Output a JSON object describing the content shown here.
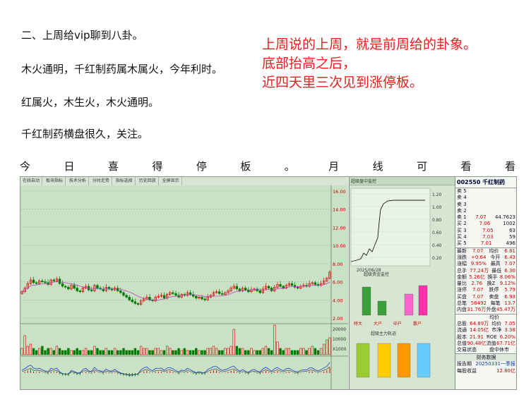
{
  "paragraphs": [
    "二、上周给vip聊到八卦。",
    "木火通明，千红制药属木属火，今年利时。",
    "红属火，木生火，木火通明。",
    "千红制药横盘很久，关注。"
  ],
  "red_note": [
    "上周说的上周，就是前周给的卦象。",
    "底部抬高之后，",
    "近四天里三次见到涨停板。"
  ],
  "spaced_line": [
    "今",
    "日",
    "喜",
    "得",
    "停",
    "板",
    "。",
    "月",
    "线",
    "可",
    "看",
    "看"
  ],
  "software": {
    "toolbar": [
      "在线自动",
      "板块指标",
      "技术分析",
      "分时走势",
      "指标选择",
      "历史回放",
      "全屏显示"
    ],
    "kline_axis": [
      "16.00",
      "14.00",
      "12.00",
      "10.00",
      "8.00",
      "6.00",
      "4.00",
      "2.00"
    ],
    "vol_axis": [
      "20000",
      "10000",
      "X1000"
    ],
    "mid_top_label": "超级盘中监控",
    "mid_axis": [
      "1.20",
      "1.00",
      "0.80",
      "0.60",
      "0.40",
      "0.20"
    ],
    "mid_date": "2025/06/28",
    "mid_mid_label": "超级资金监控",
    "mid_bottom_label": "超级主力轨迹",
    "mid_cats": [
      "特大",
      "大户",
      "中户",
      "散户"
    ],
    "stock_title": "002550 千红制药",
    "order_book": [
      {
        "side": "卖",
        "n": "5",
        "p": "",
        "v": ""
      },
      {
        "side": "卖",
        "n": "4",
        "p": "",
        "v": ""
      },
      {
        "side": "卖",
        "n": "3",
        "p": "",
        "v": ""
      },
      {
        "side": "卖",
        "n": "2",
        "p": "",
        "v": ""
      },
      {
        "side": "卖",
        "n": "1",
        "p": "7.07",
        "v": "44.7623"
      },
      {
        "side": "买",
        "n": "2",
        "p": "7.06",
        "v": "1002"
      },
      {
        "side": "买",
        "n": "3",
        "p": "7.05",
        "v": "63"
      },
      {
        "side": "买",
        "n": "4",
        "p": "7.03",
        "v": "59"
      },
      {
        "side": "买",
        "n": "5",
        "p": "7.01",
        "v": "496"
      }
    ],
    "stats": [
      [
        "最新",
        "7.07",
        "均价",
        "6.81"
      ],
      [
        "涨跌",
        "+0.64",
        "今开",
        "6.43"
      ],
      [
        "涨幅",
        "9.95%",
        "最高",
        "7.07"
      ],
      [
        "总手",
        "77.24万",
        "最低",
        "6.30"
      ],
      [
        "金额",
        "5.26亿",
        "换手",
        "8.06%"
      ],
      [
        "量比",
        "2.76",
        "换Z",
        "9.12%"
      ],
      [
        "涨停",
        "7.07",
        "跌停",
        "5.79"
      ],
      [
        "买盘",
        "7.07",
        "卖盘",
        "6.93"
      ],
      [
        "总笔",
        "56492",
        "每笔",
        "13.7"
      ],
      [
        "内盘",
        "31.76万",
        "外盘",
        "45.47万"
      ]
    ],
    "stats2": [
      [
        "",
        "",
        "均价",
        ""
      ],
      [
        "总股",
        "64.89万",
        "均价",
        "7.05"
      ],
      [
        "流通",
        "14.05亿",
        "市净",
        "3.38"
      ],
      [
        "股本",
        "21.91",
        "ROE",
        "6.20%"
      ],
      [
        "总值",
        "90.48亿",
        "流值",
        "67.71亿"
      ],
      [
        "交易状态",
        "",
        "盘中休市",
        ""
      ]
    ],
    "bottom_tabs": "财务数据",
    "report": [
      "报告期",
      "20250331一季报",
      "每股收益",
      "12.80亿"
    ]
  },
  "chart_data": {
    "type": "candlestick",
    "y_axis": [
      2,
      16
    ],
    "closes": [
      4.9,
      5.3,
      5.8,
      6.2,
      5.9,
      5.8,
      6.1,
      6.0,
      5.9,
      5.7,
      6.2,
      6.1,
      6.3,
      5.8,
      5.5,
      5.4,
      5.2,
      5.6,
      5.3,
      5.0,
      4.9,
      5.3,
      5.5,
      5.1,
      5.0,
      5.6,
      5.3,
      5.2,
      5.0,
      5.4,
      5.2,
      5.1,
      5.3,
      5.0,
      4.8,
      4.5,
      4.3,
      4.0,
      3.8,
      3.6,
      3.5,
      3.9,
      4.1,
      4.3,
      4.0,
      3.9,
      4.3,
      4.4,
      4.5,
      4.2,
      4.6,
      4.8,
      4.7,
      4.5,
      4.3,
      4.6,
      4.5,
      4.8,
      4.6,
      4.4,
      4.2,
      4.3,
      4.1,
      4.0,
      4.3,
      4.5,
      4.8,
      4.9,
      4.7,
      4.6,
      4.8,
      5.0,
      5.3,
      5.5,
      5.2,
      5.0,
      5.3,
      5.1,
      4.9,
      5.1,
      5.2,
      5.0,
      4.8,
      5.2,
      5.5,
      5.3,
      5.0,
      5.4,
      5.7,
      5.5,
      5.3,
      5.6,
      5.8,
      5.6,
      5.4,
      5.3,
      5.5,
      5.6,
      5.5,
      5.8,
      5.9,
      5.7,
      5.6,
      5.8,
      6.1,
      6.4,
      7.07
    ],
    "volumes": [
      3,
      9,
      4,
      5,
      3,
      2,
      3,
      4,
      2,
      3,
      3,
      2,
      4,
      3,
      2,
      2,
      3,
      2,
      2,
      3,
      2,
      2,
      3,
      2,
      2,
      4,
      3,
      2,
      2,
      3,
      2,
      2,
      3,
      2,
      2,
      3,
      2,
      2,
      2,
      3,
      2,
      4,
      3,
      3,
      2,
      2,
      3,
      3,
      2,
      2,
      4,
      3,
      2,
      2,
      3,
      2,
      3,
      2,
      2,
      2,
      3,
      2,
      2,
      2,
      3,
      3,
      4,
      3,
      2,
      2,
      3,
      3,
      4,
      12,
      4,
      3,
      3,
      2,
      2,
      3,
      2,
      2,
      2,
      3,
      4,
      3,
      2,
      14,
      6,
      3,
      2,
      3,
      3,
      2,
      2,
      2,
      3,
      3,
      2,
      3,
      4,
      3,
      2,
      3,
      5,
      7,
      8
    ]
  }
}
